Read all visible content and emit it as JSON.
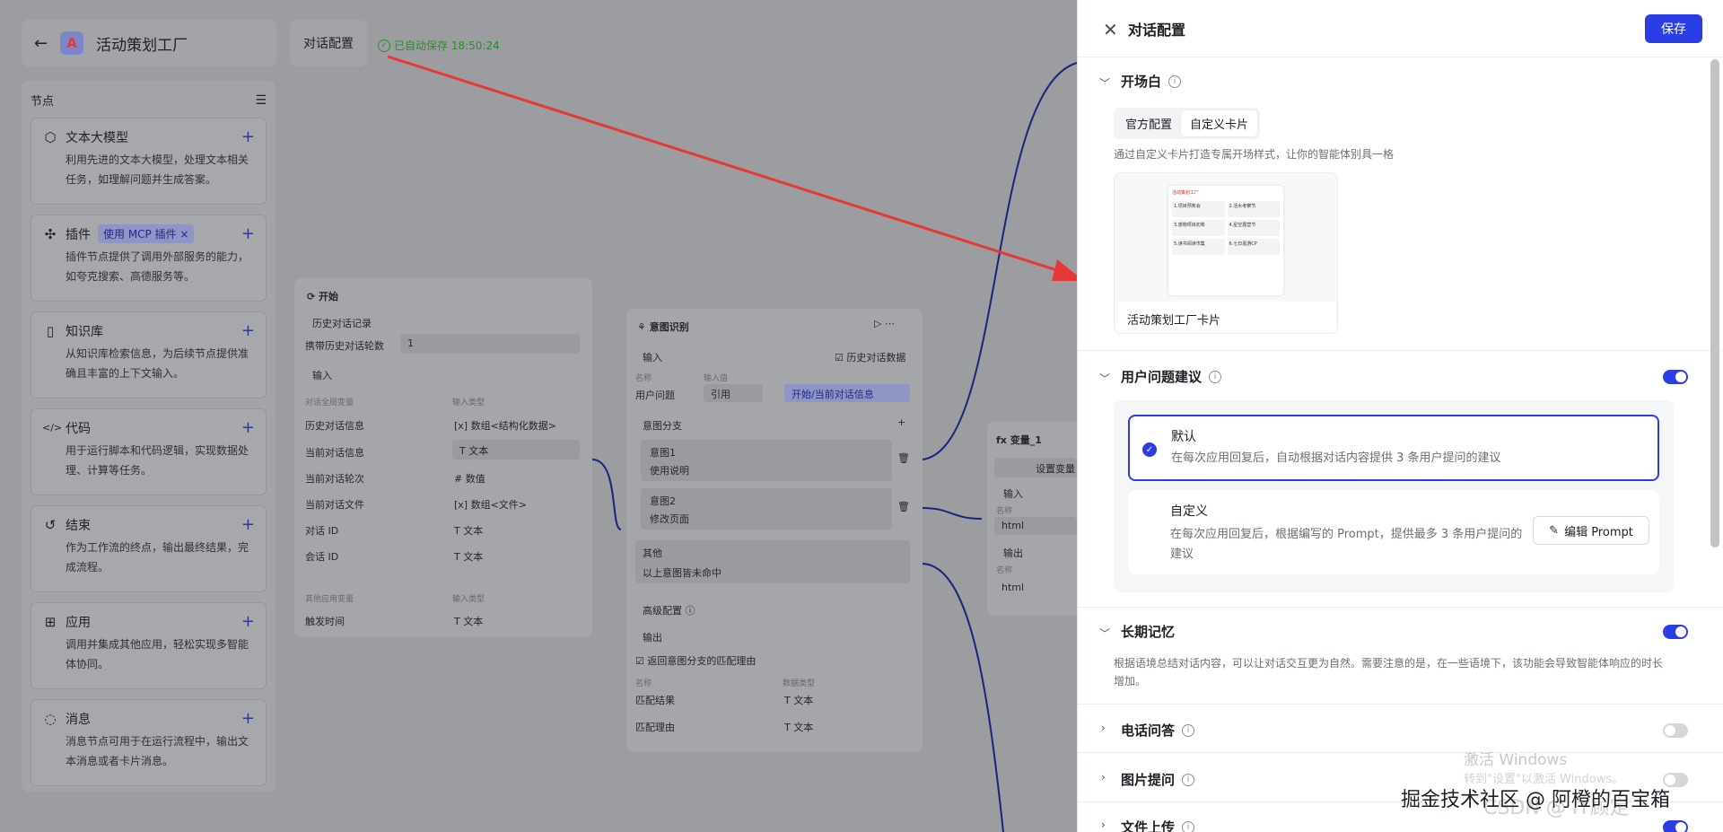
{
  "app": {
    "title": "活动策划工厂",
    "back_icon": "arrow-left-icon",
    "logo_icon": "app-logo-icon"
  },
  "header": {
    "conv_config_label": "对话配置",
    "autosave": "已自动保存 18:50:24"
  },
  "sidebar": {
    "title": "节点",
    "items": [
      {
        "name": "文本大模型",
        "icon": "cube-icon",
        "desc": "利用先进的文本大模型，处理文本相关任务，如理解问题并生成答案。"
      },
      {
        "name": "插件",
        "icon": "puzzle-icon",
        "badge": "使用 MCP 插件",
        "desc": "插件节点提供了调用外部服务的能力，如夸克搜索、高德服务等。"
      },
      {
        "name": "知识库",
        "icon": "book-icon",
        "desc": "从知识库检索信息，为后续节点提供准确且丰富的上下文输入。"
      },
      {
        "name": "代码",
        "icon": "code-icon",
        "desc": "用于运行脚本和代码逻辑，实现数据处理、计算等任务。"
      },
      {
        "name": "结束",
        "icon": "end-icon",
        "desc": "作为工作流的终点，输出最终结果，完成流程。"
      },
      {
        "name": "应用",
        "icon": "apps-icon",
        "desc": "调用并集成其他应用，轻松实现多智能体协同。"
      },
      {
        "name": "消息",
        "icon": "message-icon",
        "desc": "消息节点可用于在运行流程中，输出文本消息或者卡片消息。"
      }
    ]
  },
  "start_node": {
    "title": "开始",
    "history_label": "历史对话记录",
    "carry_rounds_label": "携带历史对话轮数",
    "carry_rounds_value": "1",
    "input_label": "输入",
    "col_var": "对话全局变量",
    "col_type": "输入类型",
    "rows": [
      {
        "name": "历史对话信息",
        "type": "数组<结构化数据>"
      },
      {
        "name": "当前对话信息",
        "type": "文本"
      },
      {
        "name": "当前对话轮次",
        "type": "数值"
      },
      {
        "name": "当前对话文件",
        "type": "数组<文件>"
      },
      {
        "name": "对话 ID",
        "type": "文本"
      },
      {
        "name": "会话 ID",
        "type": "文本"
      }
    ],
    "col_var2": "其他应用变量",
    "col_type2": "输入类型",
    "row_trigger": {
      "name": "触发时间",
      "type": "文本"
    }
  },
  "intent_node": {
    "title": "意图识别",
    "input_label": "输入",
    "history_cb": "历史对话数据",
    "col_name": "名称",
    "col_value": "输入值",
    "var_name": "用户问题",
    "ref_select": "引用",
    "ref_value": "开始/当前对话信息",
    "branch_label": "意图分支",
    "intent1_title": "意图1",
    "intent1_text": "使用说明",
    "intent2_title": "意图2",
    "intent2_text": "修改页面",
    "other_title": "其他",
    "other_text": "以上意图皆未命中",
    "advanced": "高级配置",
    "output_label": "输出",
    "return_cb": "返回意图分支的匹配理由",
    "out_col_name": "名称",
    "out_col_type": "数据类型",
    "outputs": [
      {
        "name": "匹配结果",
        "type": "文本"
      },
      {
        "name": "匹配理由",
        "type": "文本"
      }
    ]
  },
  "var_node": {
    "title": "变量_1",
    "set_btn": "设置变量",
    "input_label": "输入",
    "name_label": "名称",
    "in_value": "html",
    "output_label": "输出",
    "name_label2": "名称",
    "out_value": "html"
  },
  "drawer": {
    "title": "对话配置",
    "save": "保存",
    "opening": {
      "title": "开场白",
      "tabs": [
        "官方配置",
        "自定义卡片"
      ],
      "active_tab": 1,
      "desc": "通过自定义卡片打造专属开场样式，让你的智能体别具一格",
      "card_label": "活动策划工厂卡片",
      "preview_title": "活动策划工厂",
      "preview_items": [
        "1.项目预筹会",
        "2.活水考察节",
        "3.感物项目初筹",
        "4.星空露营节",
        "5.读书阅读市集",
        "6.七日嘉游CP"
      ]
    },
    "suggest": {
      "title": "用户问题建议",
      "enabled": true,
      "options": [
        {
          "title": "默认",
          "desc": "在每次应用回复后，自动根据对话内容提供 3 条用户提问的建议",
          "selected": true
        },
        {
          "title": "自定义",
          "desc": "在每次应用回复后，根据编写的 Prompt，提供最多 3 条用户提问的建议",
          "selected": false,
          "button": "编辑 Prompt"
        }
      ]
    },
    "memory": {
      "title": "长期记忆",
      "enabled": true,
      "desc": "根据语境总结对话内容，可以让对话交互更为自然。需要注意的是，在一些语境下，该功能会导致智能体响应的时长增加。"
    },
    "phone": {
      "title": "电话问答",
      "enabled": false
    },
    "image": {
      "title": "图片提问",
      "enabled": false
    },
    "file": {
      "title": "文件上传",
      "enabled": true
    }
  },
  "overlay": {
    "activate_title": "激活 Windows",
    "activate_sub": "转到\"设置\"以激活 Windows。",
    "juejin": "掘金技术社区 @ 阿橙的百宝箱",
    "csdn": "CSDN @ IT顾定"
  },
  "colors": {
    "accent": "#2b3ee6",
    "arrow": "#e53935",
    "edge": "#1a237e",
    "saved": "#2e8a2e"
  }
}
